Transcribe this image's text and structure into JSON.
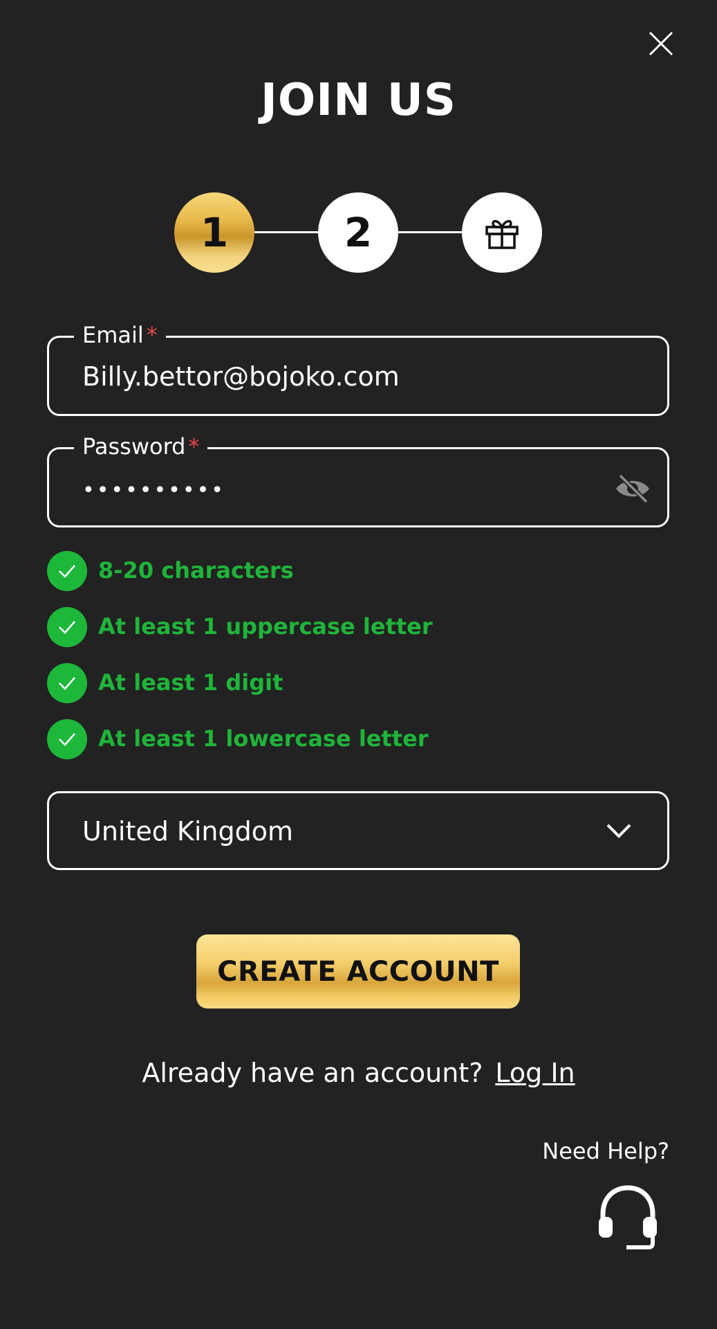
{
  "title": "JOIN US",
  "stepper": {
    "steps": [
      {
        "label": "1",
        "state": "active"
      },
      {
        "label": "2",
        "state": "inactive"
      },
      {
        "icon": "gift-icon",
        "state": "inactive"
      }
    ]
  },
  "email": {
    "label": "Email",
    "required_marker": "*",
    "value": "Billy.bettor@bojoko.com"
  },
  "password": {
    "label": "Password",
    "required_marker": "*",
    "masked_value": "••••••••••",
    "toggle_icon": "eye-slash-icon"
  },
  "requirements": [
    {
      "text": "8-20 characters",
      "met": true
    },
    {
      "text": "At least 1 uppercase letter",
      "met": true
    },
    {
      "text": "At least 1 digit",
      "met": true
    },
    {
      "text": "At least 1 lowercase letter",
      "met": true
    }
  ],
  "country": {
    "selected": "United Kingdom"
  },
  "create_button": "CREATE ACCOUNT",
  "login": {
    "prompt": "Already have an account?",
    "link": "Log In"
  },
  "help": {
    "label": "Need Help?",
    "icon": "headset-icon"
  },
  "colors": {
    "background": "#222222",
    "success": "#1db83a",
    "required": "#e54848",
    "gold": "#e8b84a"
  }
}
